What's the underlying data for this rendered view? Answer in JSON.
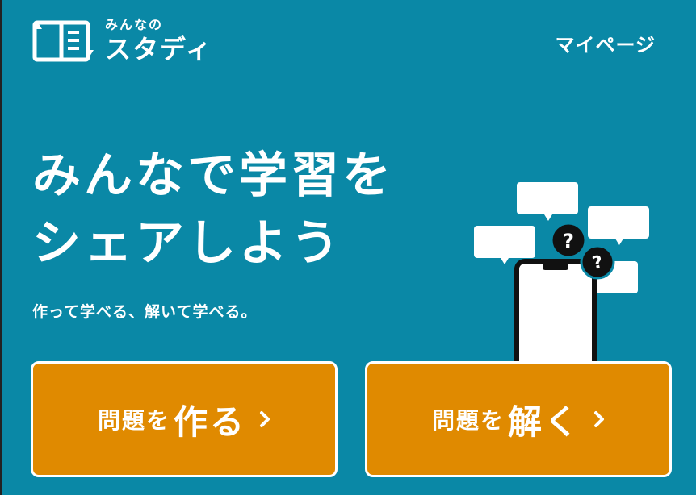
{
  "header": {
    "logo_small": "みんなの",
    "logo_big": "スタディ",
    "mypage_label": "マイページ"
  },
  "hero": {
    "title_line1": "みんなで学習を",
    "title_line2": "シェアしよう",
    "subtitle": "作って学べる、解いて学べる。"
  },
  "buttons": {
    "make": {
      "prefix": "問題を",
      "verb": "作る"
    },
    "solve": {
      "prefix": "問題を",
      "verb": "解く"
    }
  },
  "colors": {
    "background": "#0a88a6",
    "button": "#e08a00",
    "text": "#ffffff"
  },
  "icons": [
    "logo-book-icon",
    "chevron-right-icon",
    "smartphone-icon",
    "speech-bubble-icon",
    "question-icon"
  ]
}
